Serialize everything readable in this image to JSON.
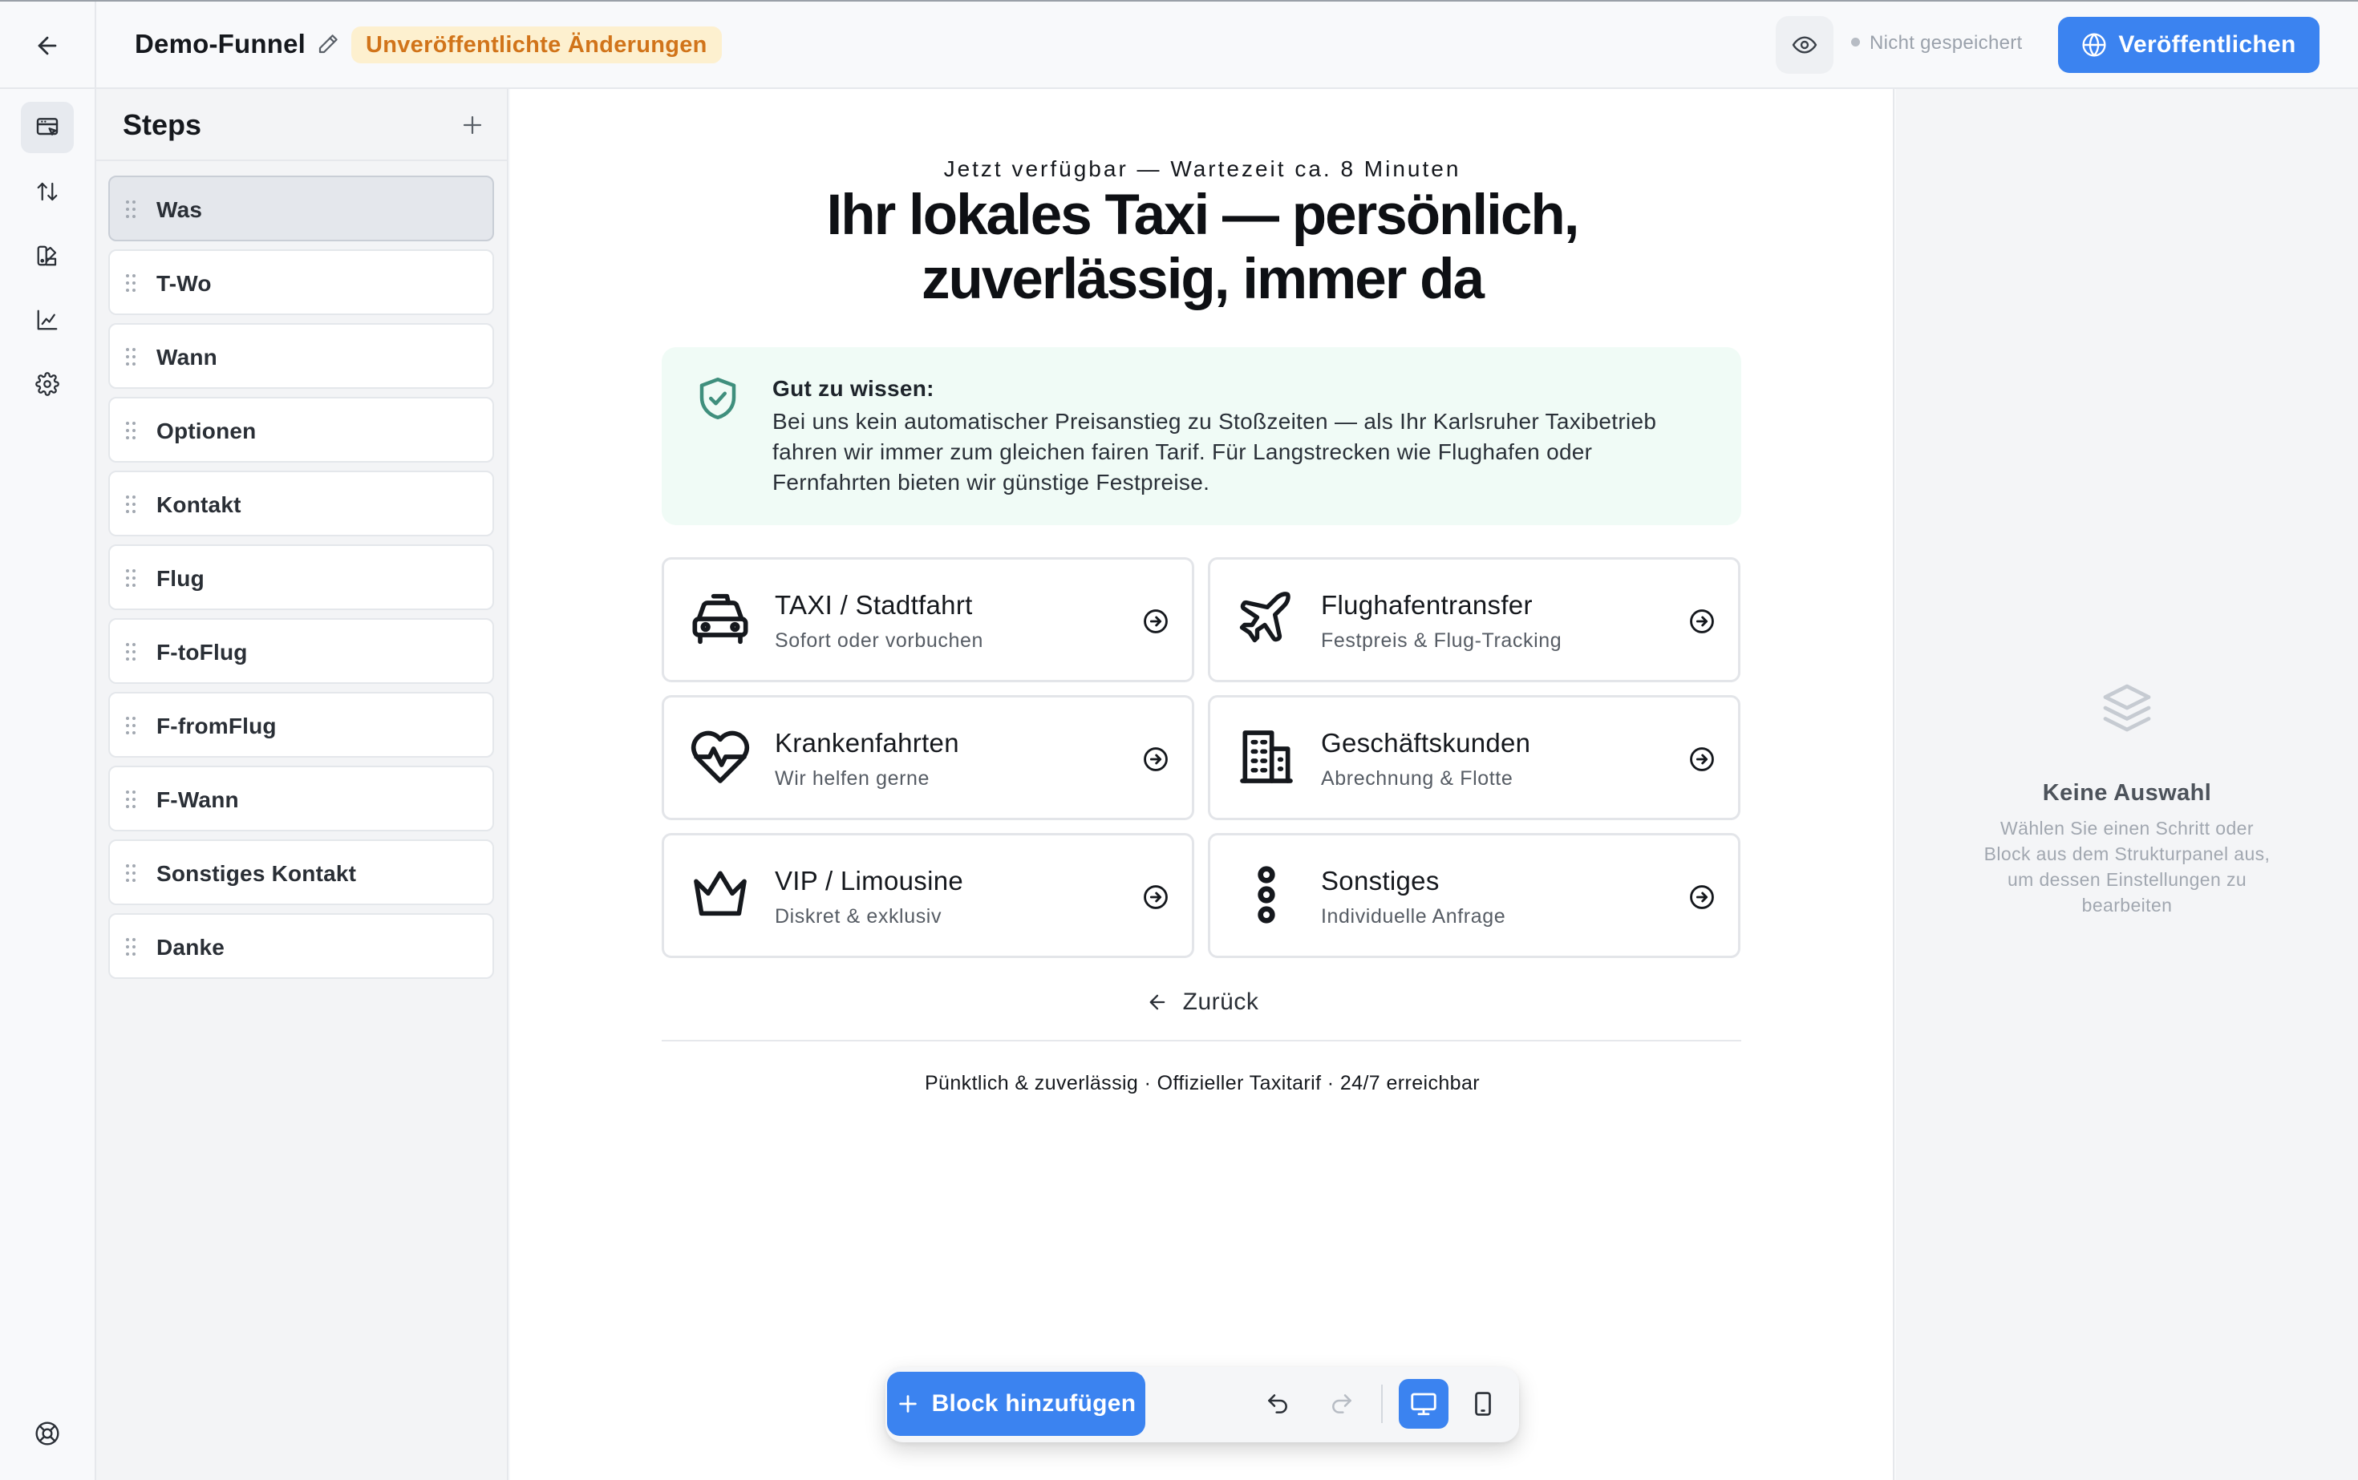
{
  "header": {
    "title": "Demo-Funnel",
    "unsaved_badge": "Unveröffentlichte Änderungen",
    "save_status": "Nicht gespeichert",
    "publish_label": "Veröffentlichen"
  },
  "steps": {
    "title": "Steps",
    "items": [
      {
        "label": "Was"
      },
      {
        "label": "T-Wo"
      },
      {
        "label": "Wann"
      },
      {
        "label": "Optionen"
      },
      {
        "label": "Kontakt"
      },
      {
        "label": "Flug"
      },
      {
        "label": "F-toFlug"
      },
      {
        "label": "F-fromFlug"
      },
      {
        "label": "F-Wann"
      },
      {
        "label": "Sonstiges Kontakt"
      },
      {
        "label": "Danke"
      }
    ]
  },
  "canvas": {
    "subline": "Jetzt verfügbar — Wartezeit ca. 8 Minuten",
    "headline_line1": "Ihr lokales Taxi — persönlich,",
    "headline_line2": "zuverlässig, immer da",
    "info": {
      "title": "Gut zu wissen:",
      "text": "Bei uns kein automatischer Preisanstieg zu Stoßzeiten — als Ihr Karlsruher Taxibetrieb fahren wir immer zum gleichen fairen Tarif. Für Langstrecken wie Flughafen oder Fernfahrten bieten wir günstige Festpreise."
    },
    "options": [
      {
        "title": "TAXI / Stadtfahrt",
        "subtitle": "Sofort oder vorbuchen",
        "icon": "taxi-icon"
      },
      {
        "title": "Flughafentransfer",
        "subtitle": "Festpreis & Flug-Tracking",
        "icon": "plane-icon"
      },
      {
        "title": "Krankenfahrten",
        "subtitle": "Wir helfen gerne",
        "icon": "heart-pulse-icon"
      },
      {
        "title": "Geschäftskunden",
        "subtitle": "Abrechnung & Flotte",
        "icon": "building-icon"
      },
      {
        "title": "VIP / Limousine",
        "subtitle": "Diskret & exklusiv",
        "icon": "crown-icon"
      },
      {
        "title": "Sonstiges",
        "subtitle": "Individuelle Anfrage",
        "icon": "vertical-dots-icon"
      }
    ],
    "back_label": "Zurück",
    "footer": "Pünktlich & zuverlässig · Offizieller Taxitarif · 24/7 erreichbar"
  },
  "toolbar": {
    "add_block_label": "Block hinzufügen",
    "device": "desktop"
  },
  "properties": {
    "title": "Keine Auswahl",
    "text": "Wählen Sie einen Schritt oder Block aus dem Strukturpanel aus, um dessen Einstellungen zu bearbeiten"
  },
  "colors": {
    "accent": "#3b83f0",
    "badge_bg": "#fdf0cf",
    "badge_text": "#d1741a",
    "info_bg": "#f0fbf6",
    "info_icon": "#3f8f7d"
  }
}
